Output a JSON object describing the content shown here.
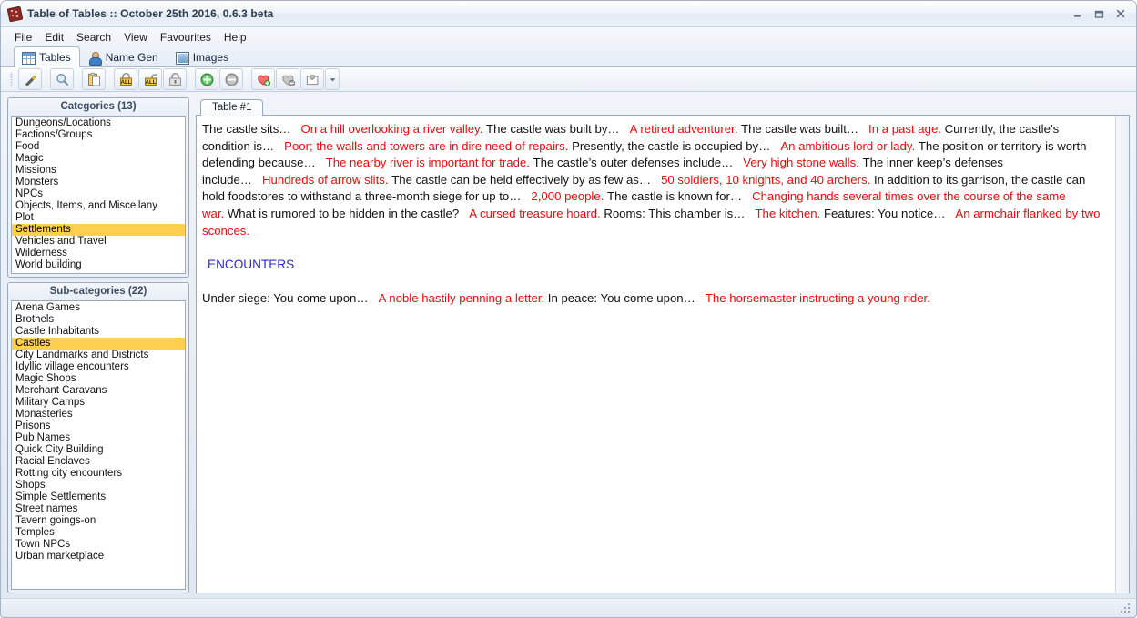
{
  "window": {
    "title": "Table of Tables :: October 25th 2016, 0.6.3 beta",
    "icon": "dice-icon",
    "controls": {
      "minimize": "minimize-icon",
      "maximize": "maximize-icon",
      "close": "close-icon"
    }
  },
  "menubar": {
    "items": [
      {
        "label": "File"
      },
      {
        "label": "Edit"
      },
      {
        "label": "Search"
      },
      {
        "label": "View"
      },
      {
        "label": "Favourites"
      },
      {
        "label": "Help"
      }
    ]
  },
  "app_tabs": [
    {
      "label": "Tables",
      "icon": "table-grid-icon",
      "selected": true
    },
    {
      "label": "Name Gen",
      "icon": "person-icon",
      "selected": false
    },
    {
      "label": "Images",
      "icon": "picture-icon",
      "selected": false
    }
  ],
  "toolbar": {
    "buttons": [
      {
        "name": "generate-wand-button",
        "icon": "magic-wand-icon",
        "tooltip": "Generate"
      },
      {
        "name": "search-button",
        "icon": "magnifier-icon",
        "tooltip": "Search"
      },
      {
        "name": "copy-clipboard-button",
        "icon": "clipboard-icon",
        "tooltip": "Copy"
      },
      {
        "name": "lock-all-button",
        "icon": "lock-all-icon",
        "tooltip": "Lock all"
      },
      {
        "name": "unlock-all-button",
        "icon": "unlock-all-icon",
        "tooltip": "Unlock all"
      },
      {
        "name": "lock-button",
        "icon": "lock-icon",
        "tooltip": "Lock"
      },
      {
        "name": "add-button",
        "icon": "plus-circle-green-icon",
        "tooltip": "Add"
      },
      {
        "name": "remove-button",
        "icon": "minus-circle-grey-icon",
        "tooltip": "Remove"
      },
      {
        "name": "add-favourite-button",
        "icon": "heart-plus-icon",
        "tooltip": "Add favourite"
      },
      {
        "name": "remove-favourite-button",
        "icon": "heart-minus-icon",
        "tooltip": "Remove favourite"
      },
      {
        "name": "favourites-folder-button",
        "icon": "heart-folder-icon",
        "tooltip": "Favourites"
      },
      {
        "name": "favourites-dropdown-button",
        "icon": "chevron-down-icon",
        "tooltip": "More"
      }
    ]
  },
  "categories": {
    "title": "Categories (13)",
    "items": [
      {
        "label": "Dungeons/Locations",
        "selected": false
      },
      {
        "label": "Factions/Groups",
        "selected": false
      },
      {
        "label": "Food",
        "selected": false
      },
      {
        "label": "Magic",
        "selected": false
      },
      {
        "label": "Missions",
        "selected": false
      },
      {
        "label": "Monsters",
        "selected": false
      },
      {
        "label": "NPCs",
        "selected": false
      },
      {
        "label": "Objects, Items, and Miscellany",
        "selected": false
      },
      {
        "label": "Plot",
        "selected": false
      },
      {
        "label": "Settlements",
        "selected": true
      },
      {
        "label": "Vehicles and Travel",
        "selected": false
      },
      {
        "label": "Wilderness",
        "selected": false
      },
      {
        "label": "World building",
        "selected": false
      }
    ]
  },
  "subcategories": {
    "title": "Sub-categories (22)",
    "items": [
      {
        "label": "Arena Games",
        "selected": false
      },
      {
        "label": "Brothels",
        "selected": false
      },
      {
        "label": "Castle Inhabitants",
        "selected": false
      },
      {
        "label": "Castles",
        "selected": true
      },
      {
        "label": "City Landmarks and Districts",
        "selected": false
      },
      {
        "label": "Idyllic village encounters",
        "selected": false
      },
      {
        "label": "Magic Shops",
        "selected": false
      },
      {
        "label": "Merchant Caravans",
        "selected": false
      },
      {
        "label": "Military Camps",
        "selected": false
      },
      {
        "label": "Monasteries",
        "selected": false
      },
      {
        "label": "Prisons",
        "selected": false
      },
      {
        "label": "Pub Names",
        "selected": false
      },
      {
        "label": "Quick City Building",
        "selected": false
      },
      {
        "label": "Racial Enclaves",
        "selected": false
      },
      {
        "label": "Rotting city encounters",
        "selected": false
      },
      {
        "label": "Shops",
        "selected": false
      },
      {
        "label": "Simple Settlements",
        "selected": false
      },
      {
        "label": "Street names",
        "selected": false
      },
      {
        "label": "Tavern goings-on",
        "selected": false
      },
      {
        "label": "Temples",
        "selected": false
      },
      {
        "label": "Town NPCs",
        "selected": false
      },
      {
        "label": "Urban marketplace",
        "selected": false
      }
    ]
  },
  "document": {
    "tab_label": "Table #1",
    "encounters_heading": "ENCOUNTERS",
    "main_segments": [
      {
        "text": "The castle sits…",
        "color": "black"
      },
      {
        "text": "On a hill overlooking a river valley.",
        "color": "red"
      },
      {
        "text": "The castle was built by…",
        "color": "black"
      },
      {
        "text": "A retired adventurer.",
        "color": "red"
      },
      {
        "text": "The castle was built…",
        "color": "black"
      },
      {
        "text": "In a past age.",
        "color": "red"
      },
      {
        "text": "Currently, the castle’s condition is…",
        "color": "black"
      },
      {
        "text": "Poor; the walls and towers are in dire need of repairs.",
        "color": "red"
      },
      {
        "text": "Presently, the castle is occupied by…",
        "color": "black"
      },
      {
        "text": "An ambitious lord or lady.",
        "color": "red"
      },
      {
        "text": "The position or territory is worth defending because…",
        "color": "black"
      },
      {
        "text": "The nearby river is important for trade.",
        "color": "red"
      },
      {
        "text": "The castle’s outer defenses include…",
        "color": "black"
      },
      {
        "text": "Very high stone walls.",
        "color": "red"
      },
      {
        "text": "The inner keep’s defenses include…",
        "color": "black"
      },
      {
        "text": "Hundreds of arrow slits.",
        "color": "red"
      },
      {
        "text": "The castle can be held effectively by as few as…",
        "color": "black"
      },
      {
        "text": "50 soldiers, 10 knights, and 40 archers.",
        "color": "red"
      },
      {
        "text": "In addition to its garrison, the castle can hold foodstores to withstand a three-month siege for up to…",
        "color": "black"
      },
      {
        "text": "2,000 people.",
        "color": "red"
      },
      {
        "text": "The castle is known for…",
        "color": "black"
      },
      {
        "text": "Changing hands several times over the course of the same war.",
        "color": "red"
      },
      {
        "text": "What is rumored to be hidden in the castle?",
        "color": "black"
      },
      {
        "text": "A cursed treasure hoard.",
        "color": "red"
      },
      {
        "text": "Rooms: This chamber is…",
        "color": "black"
      },
      {
        "text": "The kitchen.",
        "color": "red"
      },
      {
        "text": "Features: You notice…",
        "color": "black"
      },
      {
        "text": "An armchair flanked by two sconces.",
        "color": "red"
      }
    ],
    "encounter_segments": [
      {
        "text": "Under siege: You come upon…",
        "color": "black"
      },
      {
        "text": "A noble hastily penning a letter.",
        "color": "red"
      },
      {
        "text": "In peace: You come upon…",
        "color": "black"
      },
      {
        "text": "The horsemaster instructing a young rider.",
        "color": "red"
      }
    ]
  },
  "colors": {
    "result_red": "#f00a0a",
    "heading_blue": "#2b2bd4",
    "selection_yellow": "#ffcf4d",
    "body_text": "#111111"
  },
  "statusbar": {
    "resize_grip": "resize-grip-icon"
  }
}
